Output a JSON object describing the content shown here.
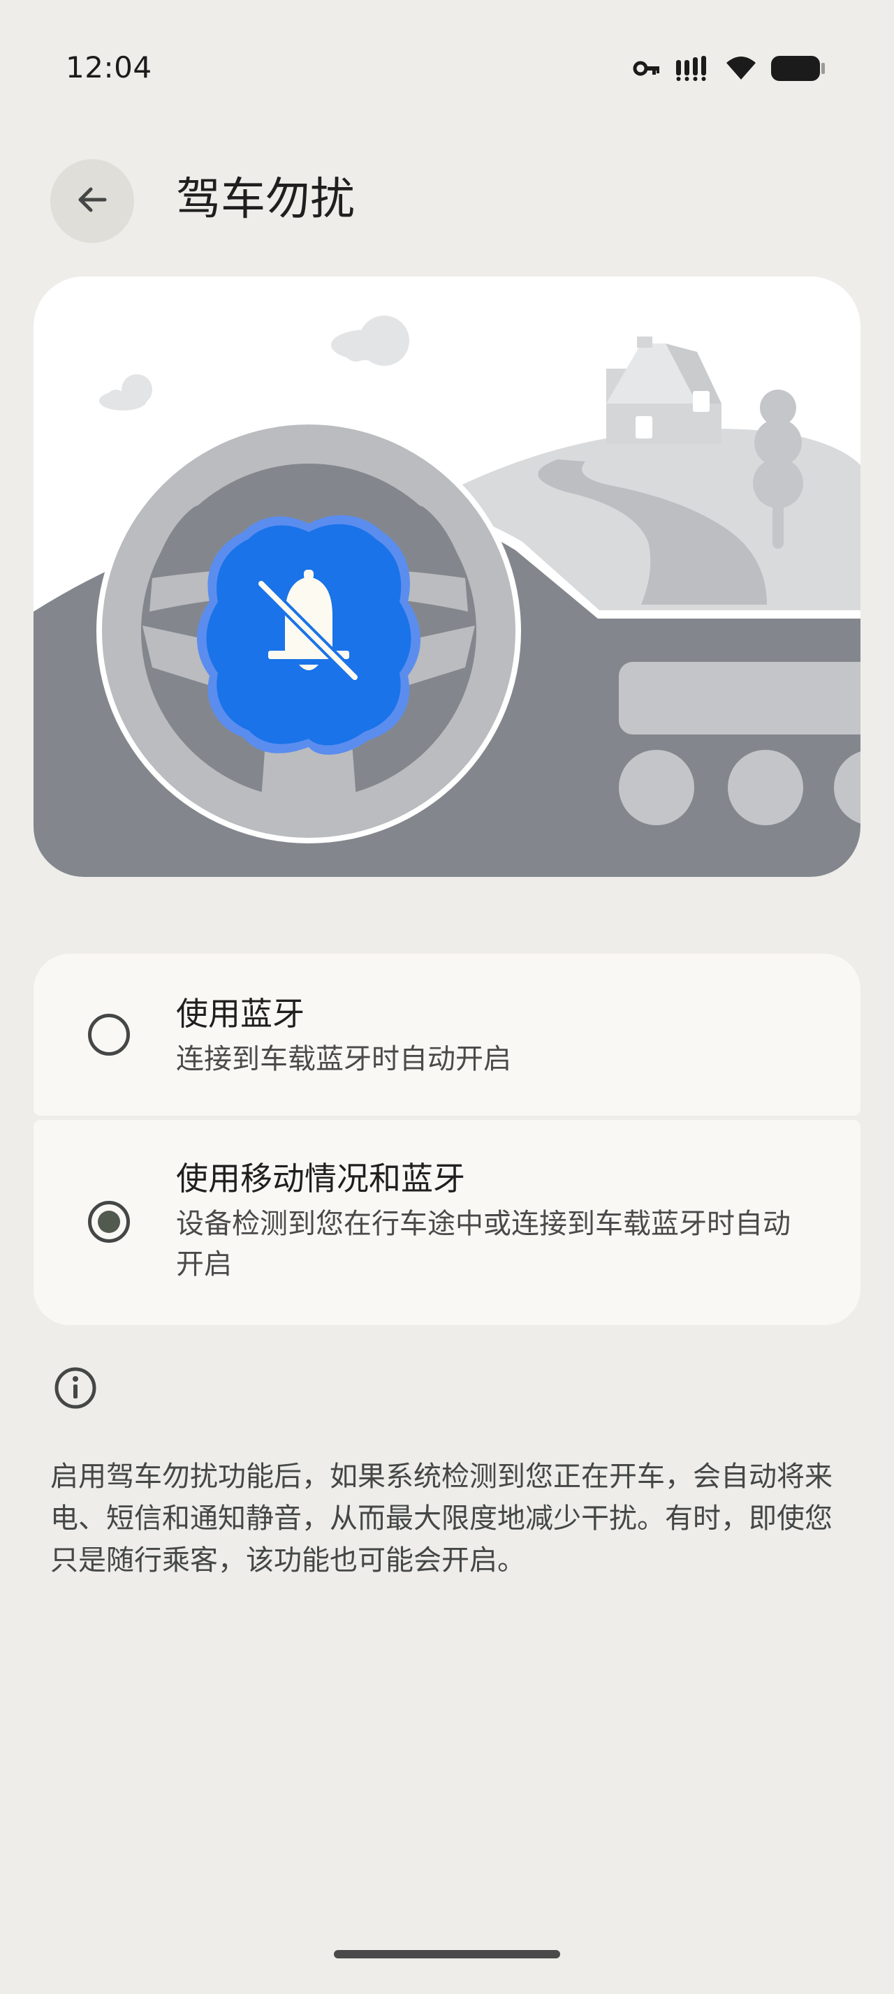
{
  "status_bar": {
    "time": "12:04",
    "icons": [
      "vpn-key-icon",
      "signal-icon",
      "wifi-icon",
      "battery-icon"
    ]
  },
  "header": {
    "title": "驾车勿扰",
    "back_icon": "arrow-back-icon"
  },
  "illustration": {
    "badge_icon": "notifications-off-icon",
    "badge_color": "#1a73e8"
  },
  "options": [
    {
      "title": "使用蓝牙",
      "subtitle": "连接到车载蓝牙时自动开启",
      "selected": false
    },
    {
      "title": "使用移动情况和蓝牙",
      "subtitle": "设备检测到您在行车途中或连接到车载蓝牙时自动开启",
      "selected": true
    }
  ],
  "info": {
    "icon": "info-icon",
    "text": "启用驾车勿扰功能后，如果系统检测到您正在开车，会自动将来电、短信和通知静音，从而最大限度地减少干扰。有时，即使您只是随行乘客，该功能也可能会开启。"
  },
  "colors": {
    "background": "#eeede9",
    "card": "#faf8f5",
    "accent": "#1a73e8"
  }
}
